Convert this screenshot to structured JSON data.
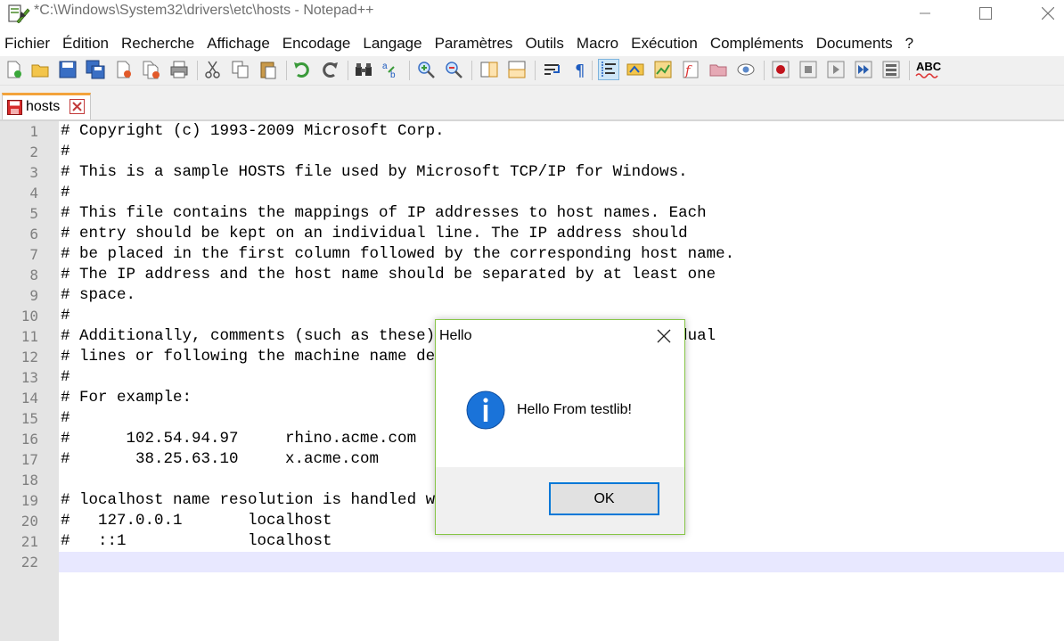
{
  "window": {
    "title": "*C:\\Windows\\System32\\drivers\\etc\\hosts - Notepad++"
  },
  "menu": {
    "items": [
      "Fichier",
      "Édition",
      "Recherche",
      "Affichage",
      "Encodage",
      "Langage",
      "Paramètres",
      "Outils",
      "Macro",
      "Exécution",
      "Compléments",
      "Documents",
      "?"
    ]
  },
  "toolbar": {
    "icons": [
      "new-file-icon",
      "open-file-icon",
      "save-icon",
      "save-all-icon",
      "close-icon",
      "close-all-icon",
      "print-icon",
      "cut-icon",
      "copy-icon",
      "paste-icon",
      "undo-icon",
      "redo-icon",
      "find-icon",
      "replace-icon",
      "zoom-in-icon",
      "zoom-out-icon",
      "sync-vertical-icon",
      "sync-horizontal-icon",
      "word-wrap-icon",
      "show-all-chars-icon",
      "indent-guide-icon",
      "user-language-icon",
      "document-map-icon",
      "function-list-icon",
      "folder-workspace-icon",
      "monitoring-icon",
      "record-macro-icon",
      "stop-record-icon",
      "play-macro-icon",
      "run-macro-multiple-icon",
      "save-macro-icon",
      "spell-check-icon"
    ],
    "spell_check_label": "ABC"
  },
  "tab": {
    "label": "hosts"
  },
  "editor": {
    "line_numbers": [
      "1",
      "2",
      "3",
      "4",
      "5",
      "6",
      "7",
      "8",
      "9",
      "10",
      "11",
      "12",
      "13",
      "14",
      "15",
      "16",
      "17",
      "18",
      "19",
      "20",
      "21",
      "22"
    ],
    "lines": [
      "# Copyright (c) 1993-2009 Microsoft Corp.",
      "#",
      "# This is a sample HOSTS file used by Microsoft TCP/IP for Windows.",
      "#",
      "# This file contains the mappings of IP addresses to host names. Each",
      "# entry should be kept on an individual line. The IP address should",
      "# be placed in the first column followed by the corresponding host name.",
      "# The IP address and the host name should be separated by at least one",
      "# space.",
      "#",
      "# Additionally, comments (such as these) may be inserted on individual",
      "# lines or following the machine name denoted by a '#' symbol.",
      "#",
      "# For example:",
      "#",
      "#      102.54.94.97     rhino.acme.com          # source server",
      "#       38.25.63.10     x.acme.com              # x client host",
      "",
      "# localhost name resolution is handled within DNS itself.",
      "#   127.0.0.1       localhost",
      "#   ::1             localhost",
      ""
    ],
    "current_line": 22
  },
  "dialog": {
    "title": "Hello",
    "message": "Hello From testlib!",
    "ok_label": "OK",
    "border_color": "#86c546",
    "icon": "information-icon"
  }
}
